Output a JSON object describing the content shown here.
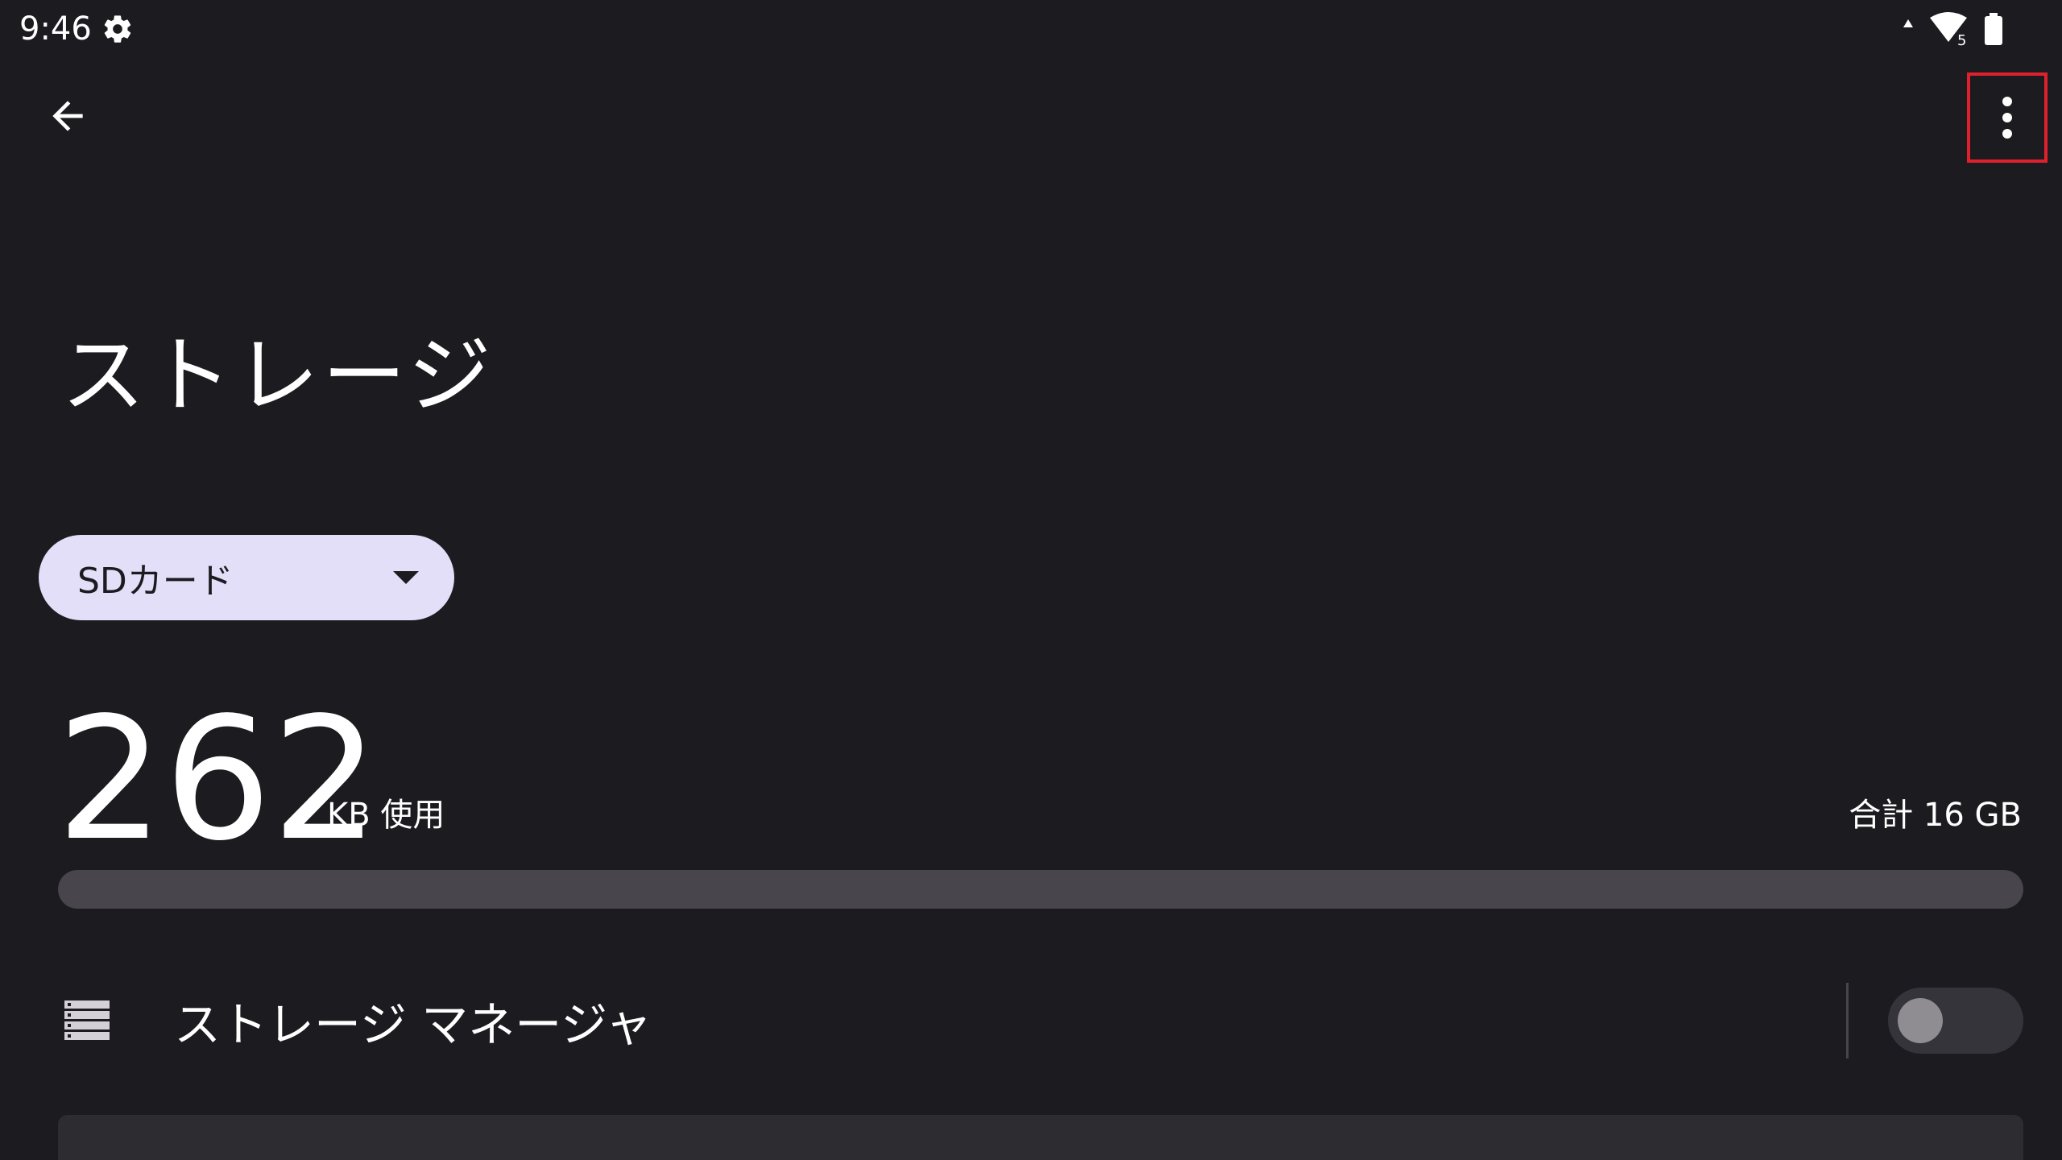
{
  "status_bar": {
    "time": "9:46",
    "icons": [
      "settings-gear-icon",
      "data-arrows-icon",
      "wifi-icon",
      "battery-icon"
    ],
    "network_badge": "5"
  },
  "app_bar": {
    "back_icon": "arrow-back-icon",
    "more_icon": "more-vert-icon",
    "more_highlight_color": "#e0202c"
  },
  "page": {
    "title": "ストレージ"
  },
  "volume_selector": {
    "selected": "SDカード"
  },
  "usage": {
    "used_value": "262",
    "used_unit": "KB 使用",
    "total": "合計 16 GB",
    "fraction_used": 0.0
  },
  "storage_manager": {
    "label": "ストレージ マネージャ",
    "enabled": false
  },
  "colors": {
    "background": "#1c1b20",
    "dropdown_bg": "#e3dff9",
    "track": "#48464c"
  }
}
